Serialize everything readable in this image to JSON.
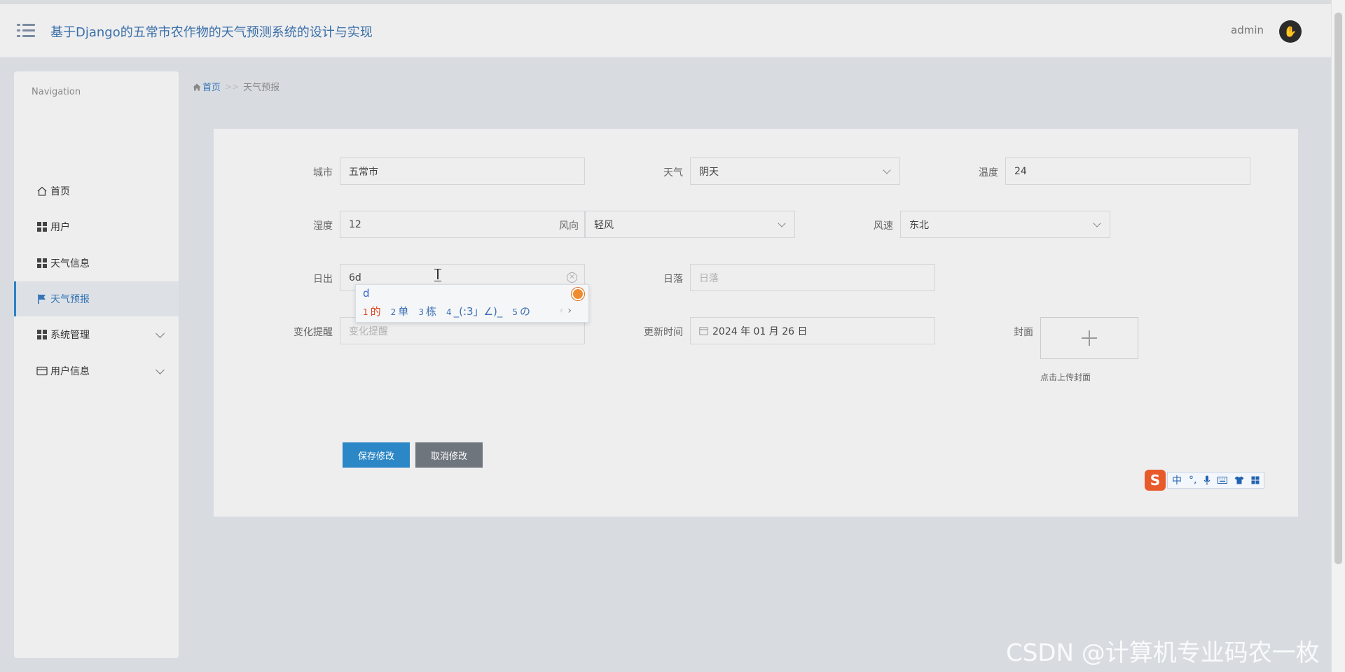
{
  "header": {
    "title": "基于Django的五常市农作物的天气预测系统的设计与实现",
    "user": "admin"
  },
  "sidebar": {
    "nav_title": "Navigation",
    "items": [
      {
        "label": "首页"
      },
      {
        "label": "用户"
      },
      {
        "label": "天气信息"
      },
      {
        "label": "天气预报"
      },
      {
        "label": "系统管理"
      },
      {
        "label": "用户信息"
      }
    ]
  },
  "breadcrumb": {
    "home": "首页",
    "sep": ">>",
    "current": "天气预报"
  },
  "form": {
    "city": {
      "label": "城市",
      "value": "五常市"
    },
    "weather": {
      "label": "天气",
      "value": "阴天"
    },
    "temperature": {
      "label": "温度",
      "value": "24"
    },
    "humidity": {
      "label": "湿度",
      "value": "12"
    },
    "wind_dir": {
      "label": "风向",
      "value": "轻风"
    },
    "wind_speed": {
      "label": "风速",
      "value": "东北"
    },
    "sunrise": {
      "label": "日出",
      "value": "6d"
    },
    "sunset": {
      "label": "日落",
      "placeholder": "日落"
    },
    "change_alert": {
      "label": "变化提醒",
      "placeholder": "变化提醒"
    },
    "update_time": {
      "label": "更新时间",
      "value": "2024 年 01 月 26 日"
    },
    "cover": {
      "label": "封面",
      "hint": "点击上传封面"
    }
  },
  "buttons": {
    "save": "保存修改",
    "cancel": "取消修改"
  },
  "ime": {
    "composition": "d",
    "candidates": [
      {
        "n": "1",
        "text": "的"
      },
      {
        "n": "2",
        "text": "单"
      },
      {
        "n": "3",
        "text": "栋"
      },
      {
        "n": "4",
        "text": "_(:3」∠)_"
      },
      {
        "n": "5",
        "text": "の"
      }
    ],
    "toolbar_mode": "中",
    "toolbar_punct": "°,"
  },
  "watermark": "CSDN @计算机专业码农一枚",
  "colors": {
    "accent": "#2b87c6",
    "title": "#3a6fa8",
    "cancel": "#6e757d"
  }
}
